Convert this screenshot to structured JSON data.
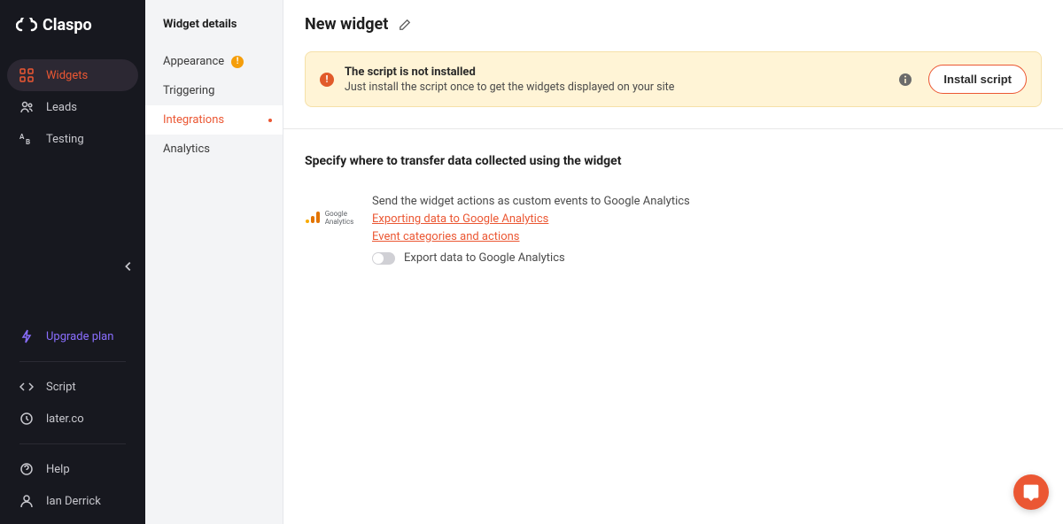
{
  "brand": "Claspo",
  "sidebar": {
    "nav": {
      "widgets": "Widgets",
      "leads": "Leads",
      "testing": "Testing"
    },
    "bottom": {
      "upgrade": "Upgrade plan",
      "script": "Script",
      "site": "later.co",
      "help": "Help",
      "user": "Ian Derrick"
    }
  },
  "subSidebar": {
    "title": "Widget details",
    "items": {
      "appearance": "Appearance",
      "triggering": "Triggering",
      "integrations": "Integrations",
      "analytics": "Analytics"
    }
  },
  "header": {
    "title": "New widget"
  },
  "alert": {
    "title": "The script is not installed",
    "desc": "Just install the script once to get the widgets displayed on your site",
    "button": "Install script"
  },
  "section": {
    "title": "Specify where to transfer data collected using the widget",
    "ga": {
      "logoLine1": "Google",
      "logoLine2": "Analytics",
      "desc": "Send the widget actions as custom events to Google Analytics",
      "link1": "Exporting data to Google Analytics",
      "link2": "Event categories and actions",
      "toggleLabel": "Export data to Google Analytics"
    }
  }
}
